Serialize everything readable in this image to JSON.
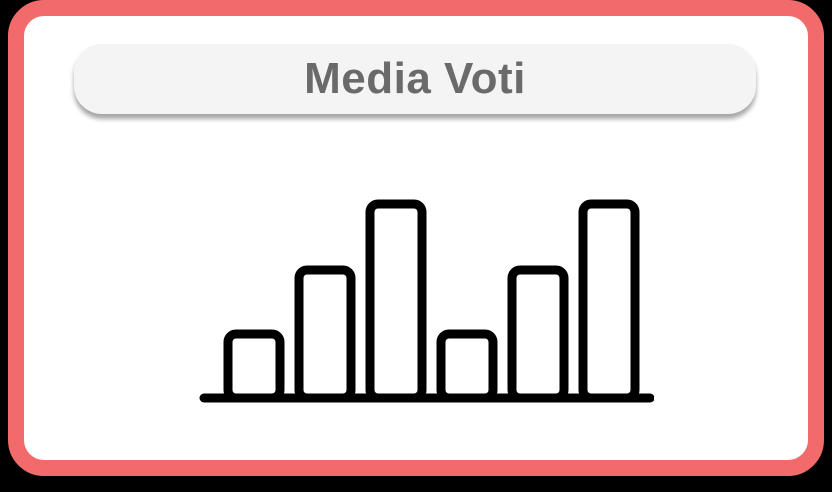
{
  "card": {
    "title": "Media Voti",
    "border_color": "#f26b6b",
    "title_text_color": "#6a6a6a"
  },
  "icon": {
    "name": "bar-chart-icon",
    "relative_levels": [
      0.33,
      0.66,
      1.0,
      0.33,
      0.66,
      1.0
    ]
  }
}
